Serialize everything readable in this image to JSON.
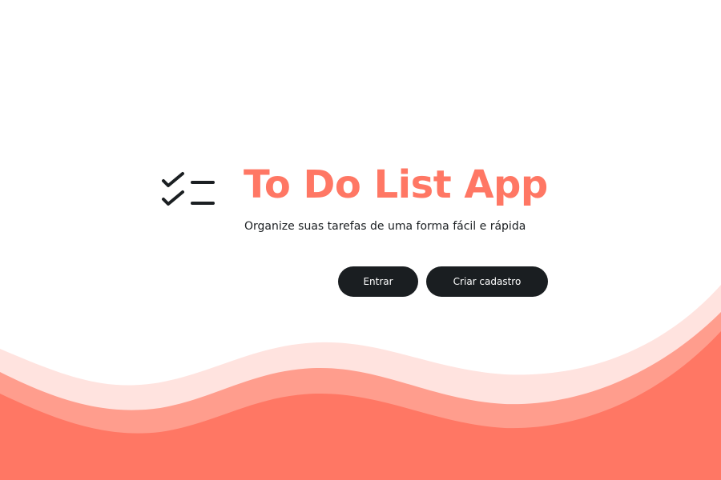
{
  "app": {
    "title": "To Do List App",
    "subtitle": "Organize suas tarefas de uma forma fácil e rápida",
    "icon": "checklist-icon"
  },
  "actions": {
    "login_label": "Entrar",
    "signup_label": "Criar cadastro"
  },
  "colors": {
    "accent": "#ff7764",
    "wave_light": "#ffe3df",
    "wave_mid": "#ff9d8d",
    "wave_dark": "#ff7764",
    "button_bg": "#1a1e21",
    "text_dark": "#1b1f22"
  }
}
